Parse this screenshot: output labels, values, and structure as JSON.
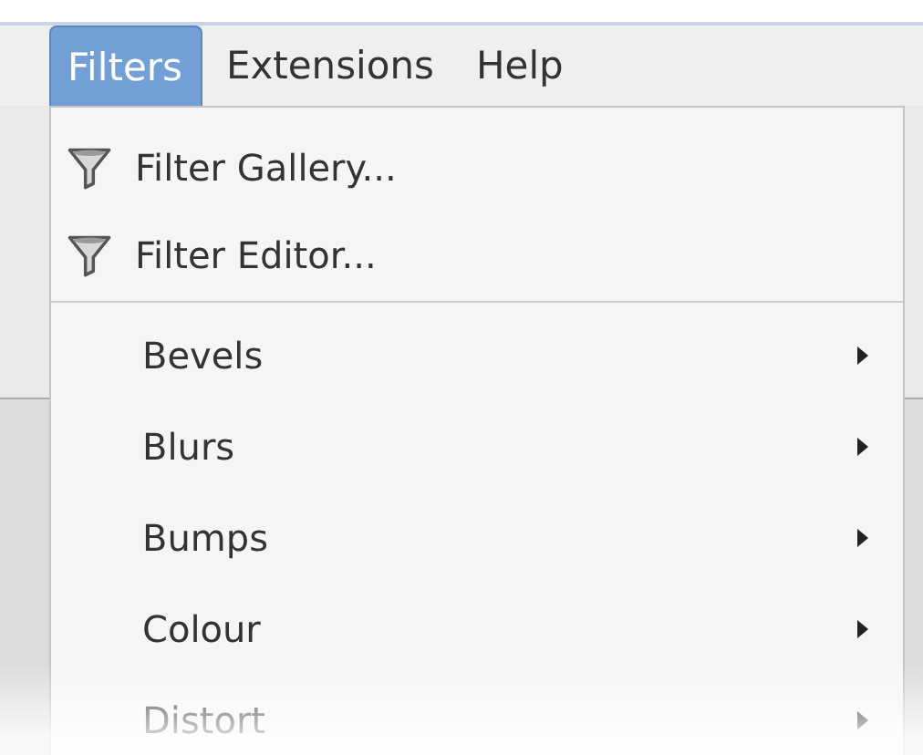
{
  "menubar": {
    "items": [
      {
        "label": "Filters",
        "selected": true
      },
      {
        "label": "Extensions",
        "selected": false
      },
      {
        "label": "Help",
        "selected": false
      }
    ]
  },
  "menu": {
    "items": [
      {
        "kind": "command",
        "label": "Filter Gallery..."
      },
      {
        "kind": "command",
        "label": "Filter Editor..."
      },
      {
        "kind": "separator"
      },
      {
        "kind": "submenu",
        "label": "Bevels"
      },
      {
        "kind": "submenu",
        "label": "Blurs"
      },
      {
        "kind": "submenu",
        "label": "Bumps"
      },
      {
        "kind": "submenu",
        "label": "Colour"
      },
      {
        "kind": "submenu",
        "label": "Distort"
      }
    ]
  }
}
